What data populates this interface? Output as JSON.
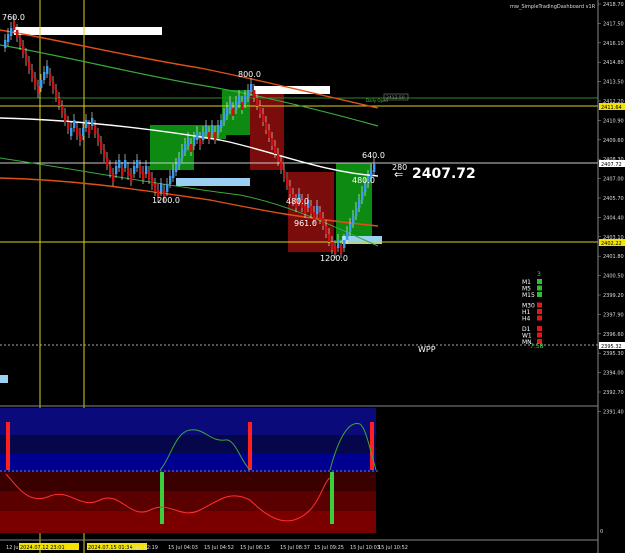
{
  "window": {
    "indicator_title": "mw_SimpleTradingDashboard v1R"
  },
  "colors": {
    "background": "#000000",
    "bull": "#3c9cf0",
    "bear": "#d01010",
    "green_box": "#0d8a12",
    "red_box": "#7a0c0c",
    "price_tag": "#f2e200",
    "ma_white": "#ffffff",
    "ma_orange": "#e05018",
    "ma_green": "#3aa83a"
  },
  "price_axis": {
    "ticks": [
      "2418.70",
      "2417.50",
      "2416.10",
      "2414.80",
      "2413.50",
      "2412.20",
      "2410.90",
      "2409.60",
      "2408.30",
      "2407.00",
      "2405.70",
      "2404.40",
      "2403.10",
      "2401.80",
      "2400.50",
      "2399.20",
      "2397.90",
      "2396.60",
      "2395.30",
      "2394.00",
      "2392.70",
      "2391.40"
    ],
    "tag_current": "2407.72",
    "tag_level_1": "2411.64",
    "tag_level_2": "2402.22",
    "tag_level_3": "2395.32"
  },
  "chart": {
    "label_760": "760.0",
    "label_800": "800.0",
    "label_1200": "1200.0",
    "label_640": "640.0",
    "label_480a": "480.0",
    "label_480b": "480.0",
    "label_961": "961.0",
    "label_bottom": "1200.0",
    "label_280": "280",
    "current_price": "2407.72",
    "label_wpp": "WPP",
    "label_box_small": "2412.50",
    "label_daily_open": "Daily Open",
    "symbol_arrow": "⇐"
  },
  "timeframe_panel": {
    "top_value": "3",
    "items": [
      "M1",
      "M5",
      "M15",
      "M30",
      "H1",
      "H4",
      "D1",
      "W1",
      "MN"
    ],
    "status": [
      "up",
      "up",
      "up",
      "down",
      "down",
      "down",
      "down",
      "down",
      "down"
    ],
    "mn_value": "7:58"
  },
  "oscillator": {
    "axis_zero": "0"
  },
  "time_axis": {
    "labels": [
      "12 Jul",
      "2024.07.12 23:01",
      "2024.07.15 01:34",
      "15 Jul 02:19",
      "15 Jul 04:03",
      "15 Jul 04:52",
      "15 Jul 06:15",
      "15 Jul 08:37",
      "15 Jul 09:25",
      "15 Jul 10:03",
      "15 Jul 10:52"
    ]
  }
}
